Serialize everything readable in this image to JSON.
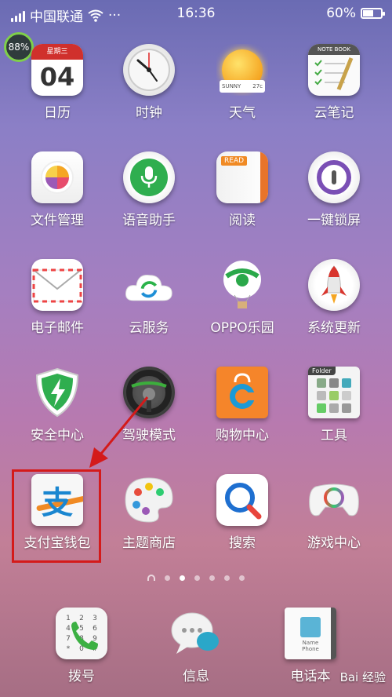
{
  "status_bar": {
    "carrier": "中国联通",
    "more": "···",
    "time": "16:36",
    "battery_text": "60%",
    "battery_level": 0.6
  },
  "memory_widget": {
    "text": "88%",
    "level": 0.88
  },
  "calendar": {
    "weekday": "星期三",
    "day": "04"
  },
  "weather": {
    "condition": "SUNNY",
    "temp": "27c"
  },
  "notebook_header": "NOTE BOOK",
  "reader_header": "READ",
  "folder_header": "Folder",
  "apps": [
    {
      "label": "日历"
    },
    {
      "label": "时钟"
    },
    {
      "label": "天气"
    },
    {
      "label": "云笔记"
    },
    {
      "label": "文件管理"
    },
    {
      "label": "语音助手"
    },
    {
      "label": "阅读"
    },
    {
      "label": "一键锁屏"
    },
    {
      "label": "电子邮件"
    },
    {
      "label": "云服务"
    },
    {
      "label": "OPPO乐园"
    },
    {
      "label": "系统更新"
    },
    {
      "label": "安全中心"
    },
    {
      "label": "驾驶模式"
    },
    {
      "label": "购物中心"
    },
    {
      "label": "工具"
    },
    {
      "label": "支付宝钱包"
    },
    {
      "label": "主题商店"
    },
    {
      "label": "搜索"
    },
    {
      "label": "游戏中心"
    }
  ],
  "alipay_glyph": "支",
  "dialer_keys": [
    "1",
    "2",
    "3",
    "4",
    "5",
    "6",
    "7",
    "8",
    "9",
    "*",
    "0",
    "#"
  ],
  "dock": [
    {
      "label": "拨号"
    },
    {
      "label": "信息"
    },
    {
      "label": "电话本"
    }
  ],
  "contact_card": {
    "name": "Name",
    "phone": "Phone"
  },
  "page_indicator": {
    "pages": 6,
    "current": 2
  },
  "watermark": "Bai 经验",
  "colors": {
    "highlight": "#d41a1a",
    "alipay_blue": "#1a86d0",
    "battery_ring": "#7fd04a"
  }
}
